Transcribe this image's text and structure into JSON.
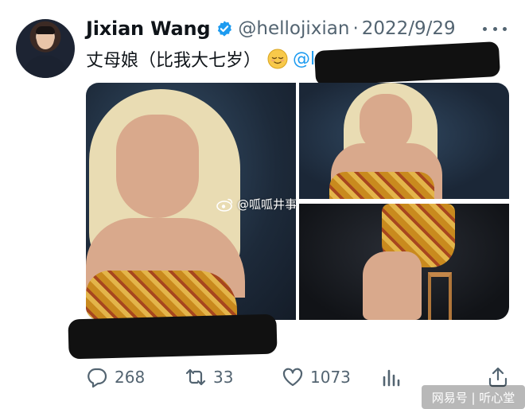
{
  "tweet": {
    "author_name": "Jixian Wang",
    "handle": "@hellojixian",
    "separator": "·",
    "date": "2022/9/29",
    "text": "丈母娘（比我大七岁）",
    "emoji": "relieved-face",
    "mention": "@l"
  },
  "watermark": {
    "icon": "weibo-icon",
    "text": "@呱呱井事"
  },
  "actions": {
    "reply_count": "268",
    "retweet_count": "33",
    "like_count": "1073"
  },
  "source_mark": {
    "text": "网易号 | 听心堂"
  },
  "colors": {
    "accent": "#1d9bf0",
    "secondary_text": "#536471",
    "primary_text": "#0f1419"
  }
}
